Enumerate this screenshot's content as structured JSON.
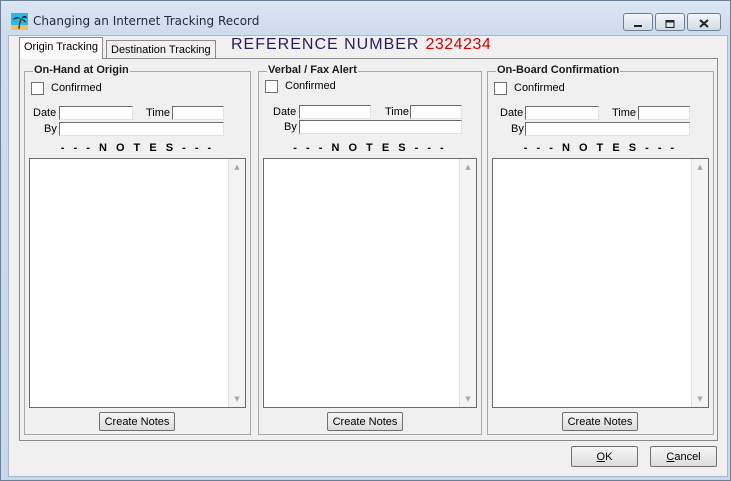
{
  "window": {
    "title": "Changing an Internet Tracking Record"
  },
  "tabs": [
    {
      "label": "Origin Tracking",
      "active": true
    },
    {
      "label": "Destination Tracking",
      "active": false
    }
  ],
  "reference": {
    "label": "REFERENCE NUMBER",
    "value": "2324234"
  },
  "colors": {
    "reference_label": "#2b1a66",
    "reference_value": "#d40000"
  },
  "groups": [
    {
      "title": "On-Hand at Origin",
      "confirmed_label": "Confirmed",
      "confirmed_checked": false,
      "date_label": "Date",
      "date_value": "",
      "time_label": "Time",
      "time_value": "",
      "by_label": "By",
      "by_value": "",
      "notes_label": "- - - N O T E S - - -",
      "notes_text": "",
      "button_label": "Create Notes"
    },
    {
      "title": "Verbal / Fax Alert",
      "confirmed_label": "Confirmed",
      "confirmed_checked": false,
      "date_label": "Date",
      "date_value": "",
      "time_label": "Time",
      "time_value": "",
      "by_label": "By",
      "by_value": "",
      "notes_label": "- - - N O T E S - - -",
      "notes_text": "",
      "button_label": "Create Notes"
    },
    {
      "title": "On-Board Confirmation",
      "confirmed_label": "Confirmed",
      "confirmed_checked": false,
      "date_label": "Date",
      "date_value": "",
      "time_label": "Time",
      "time_value": "",
      "by_label": "By",
      "by_value": "",
      "notes_label": "- - - N O T E S - - -",
      "notes_text": "",
      "button_label": "Create Notes"
    }
  ],
  "footer": {
    "ok_first": "O",
    "ok_rest": "K",
    "cancel_first": "C",
    "cancel_rest": "ancel"
  },
  "icons": {
    "app": "palm-tree-icon",
    "minimize": "minimize-icon",
    "maximize": "maximize-icon",
    "close": "close-icon"
  }
}
